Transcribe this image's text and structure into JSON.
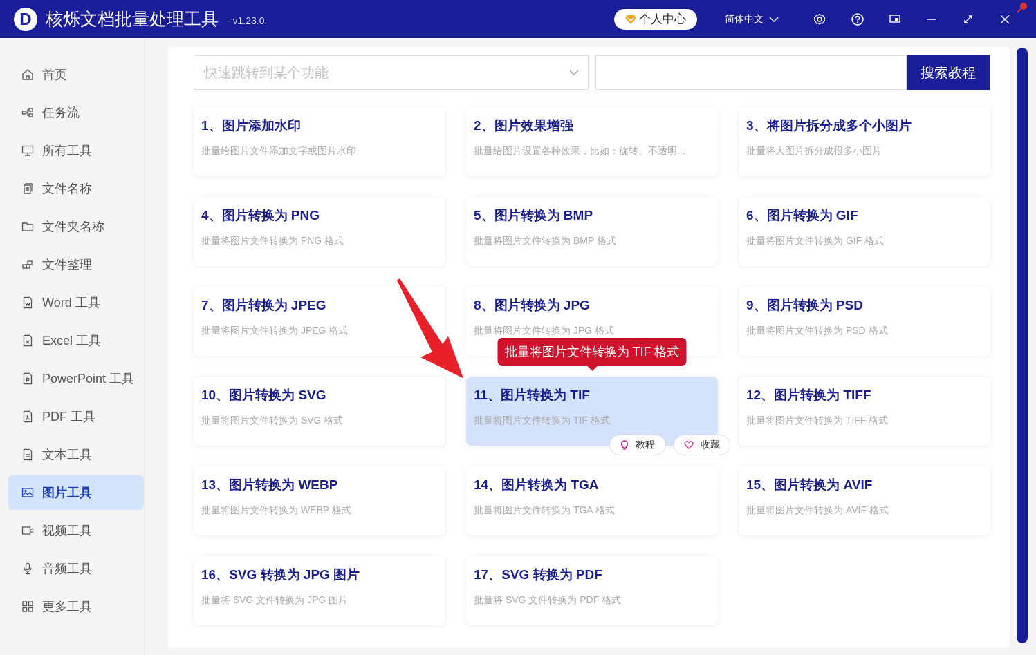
{
  "titlebar": {
    "logo_letter": "D",
    "title": "核烁文档批量处理工具",
    "version": "- v1.23.0",
    "user_button": "个人中心",
    "language": "简体中文"
  },
  "sidebar": {
    "items": [
      {
        "label": "首页",
        "selected": false
      },
      {
        "label": "任务流",
        "selected": false
      },
      {
        "label": "所有工具",
        "selected": false
      },
      {
        "label": "文件名称",
        "selected": false
      },
      {
        "label": "文件夹名称",
        "selected": false
      },
      {
        "label": "文件整理",
        "selected": false
      },
      {
        "label": "Word 工具",
        "selected": false
      },
      {
        "label": "Excel 工具",
        "selected": false
      },
      {
        "label": "PowerPoint 工具",
        "selected": false
      },
      {
        "label": "PDF 工具",
        "selected": false
      },
      {
        "label": "文本工具",
        "selected": false
      },
      {
        "label": "图片工具",
        "selected": true
      },
      {
        "label": "视频工具",
        "selected": false
      },
      {
        "label": "音频工具",
        "selected": false
      },
      {
        "label": "更多工具",
        "selected": false
      }
    ]
  },
  "search": {
    "placeholder": "快速跳转到某个功能",
    "button": "搜索教程"
  },
  "cards": [
    {
      "title": "1、图片添加水印",
      "description": "批量给图片文件添加文字或图片水印",
      "selected": false
    },
    {
      "title": "2、图片效果增强",
      "description": "批量给图片设置各种效果，比如：旋转、不透明...",
      "selected": false
    },
    {
      "title": "3、将图片拆分成多个小图片",
      "description": "批量将大图片拆分成很多小图片",
      "selected": false
    },
    {
      "title": "4、图片转换为 PNG",
      "description": "批量将图片文件转换为 PNG 格式",
      "selected": false
    },
    {
      "title": "5、图片转换为 BMP",
      "description": "批量将图片文件转换为 BMP 格式",
      "selected": false
    },
    {
      "title": "6、图片转换为 GIF",
      "description": "批量将图片文件转换为 GIF 格式",
      "selected": false
    },
    {
      "title": "7、图片转换为 JPEG",
      "description": "批量将图片文件转换为 JPEG 格式",
      "selected": false
    },
    {
      "title": "8、图片转换为 JPG",
      "description": "批量将图片文件转换为 JPG 格式",
      "selected": false
    },
    {
      "title": "9、图片转换为 PSD",
      "description": "批量将图片文件转换为 PSD 格式",
      "selected": false
    },
    {
      "title": "10、图片转换为 SVG",
      "description": "批量将图片文件转换为 SVG 格式",
      "selected": false
    },
    {
      "title": "11、图片转换为 TIF",
      "description": "批量将图片文件转换为 TIF 格式",
      "selected": true
    },
    {
      "title": "12、图片转换为 TIFF",
      "description": "批量将图片文件转换为 TIFF 格式",
      "selected": false
    },
    {
      "title": "13、图片转换为 WEBP",
      "description": "批量将图片文件转换为 WEBP 格式",
      "selected": false
    },
    {
      "title": "14、图片转换为 TGA",
      "description": "批量将图片文件转换为 TGA 格式",
      "selected": false
    },
    {
      "title": "15、图片转换为 AVIF",
      "description": "批量将图片文件转换为 AVIF 格式",
      "selected": false
    },
    {
      "title": "16、SVG 转换为 JPG 图片",
      "description": "批量将 SVG 文件转换为 JPG 图片",
      "selected": false
    },
    {
      "title": "17、SVG 转换为 PDF",
      "description": "批量将 SVG 文件转换为 PDF 格式",
      "selected": false
    }
  ],
  "hover_tooltip": "批量将图片文件转换为 TIF 格式",
  "card_actions": [
    "教程",
    "收藏"
  ]
}
